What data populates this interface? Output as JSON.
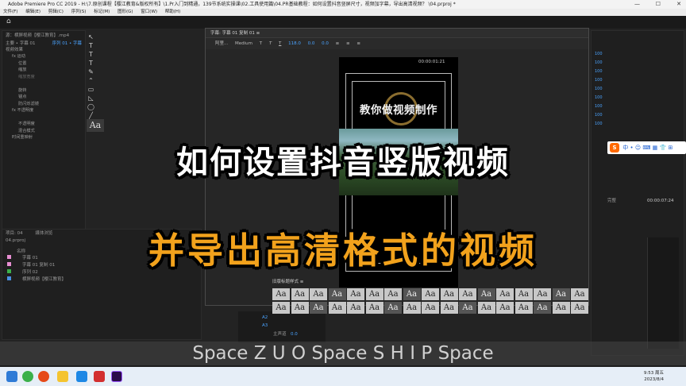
{
  "titlebar": {
    "text": "Adobe Premiere Pro CC 2019 - H:\\7.原创课程【樱江教育&版权所有】\\1.Pr入门到精通，139节系统实操课\\02.工具使用篇\\04.PR基础教程：如何设置抖音竖屏尺寸，视频加字幕，导出高清视频？ \\04.prproj *",
    "minimize": "—",
    "maximize": "☐",
    "close": "✕"
  },
  "menubar": [
    "文件(F)",
    "编辑(E)",
    "剪辑(C)",
    "序列(S)",
    "标记(M)",
    "图形(G)",
    "窗口(W)",
    "帮助(H)"
  ],
  "effect_controls": {
    "tab": "源：横屏视频【樱江教育】.mp4",
    "master": "主要 • 字幕 01",
    "sequence": "序列 01 • 字幕",
    "section": "视频效果",
    "rows": [
      "fx  运动",
      "位置",
      "缩放",
      "缩放宽度",
      "",
      "旋转",
      "锚点",
      "防闪烁滤镜",
      "fx  不透明度",
      "",
      "不透明度",
      "混合模式",
      "时间重映射"
    ]
  },
  "tools_label": "Aa",
  "project": {
    "tabs": [
      "项目: 04",
      "媒体浏览"
    ],
    "file": "04.prproj",
    "col_name": "名称",
    "items": [
      {
        "name": "字幕 01",
        "color": "#e88fd3"
      },
      {
        "name": "字幕 01 复制 01",
        "color": "#e88fd3"
      },
      {
        "name": "序列 02",
        "color": "#3bb04a"
      },
      {
        "name": "横屏视频【樱江教育】",
        "color": "#4a90e2"
      }
    ]
  },
  "title_dialog": {
    "header": "字幕: 字幕 01 复制 01  ≡",
    "font": "阿里...",
    "style": "Medium",
    "size": "118.0",
    "kerning": "0.0",
    "leading": "0.0",
    "canvas_title": "教你做视频制作",
    "canvas_time": "00:00:01:21",
    "styles_header": "旧版标题样式  ≡",
    "style_sample": "Aa",
    "right_numbers": [
      "100",
      "100",
      "100",
      "100",
      "100",
      "100",
      "100",
      "100",
      "100"
    ]
  },
  "program_monitor": {
    "timecode": "00:00:07:24",
    "label": "完整"
  },
  "timeline": {
    "tracks": [
      "A2",
      "A3"
    ],
    "master": "主声道",
    "master_val": "0.0"
  },
  "captions": {
    "line1": "如何设置抖音竖版视频",
    "line2": "并导出高清格式的视频"
  },
  "keys_overlay": "Space Z U O Space S H I P Space",
  "ime": {
    "logo": "S",
    "items": "中 • ☺ ⌨ ▦ 👕 ⊞"
  },
  "clock": {
    "time": "9:53 周五",
    "date": "2023/8/4"
  },
  "colors": {
    "accent": "#f2a21c",
    "taskbar": "#e6eef7",
    "panel": "#1f1f1f"
  }
}
